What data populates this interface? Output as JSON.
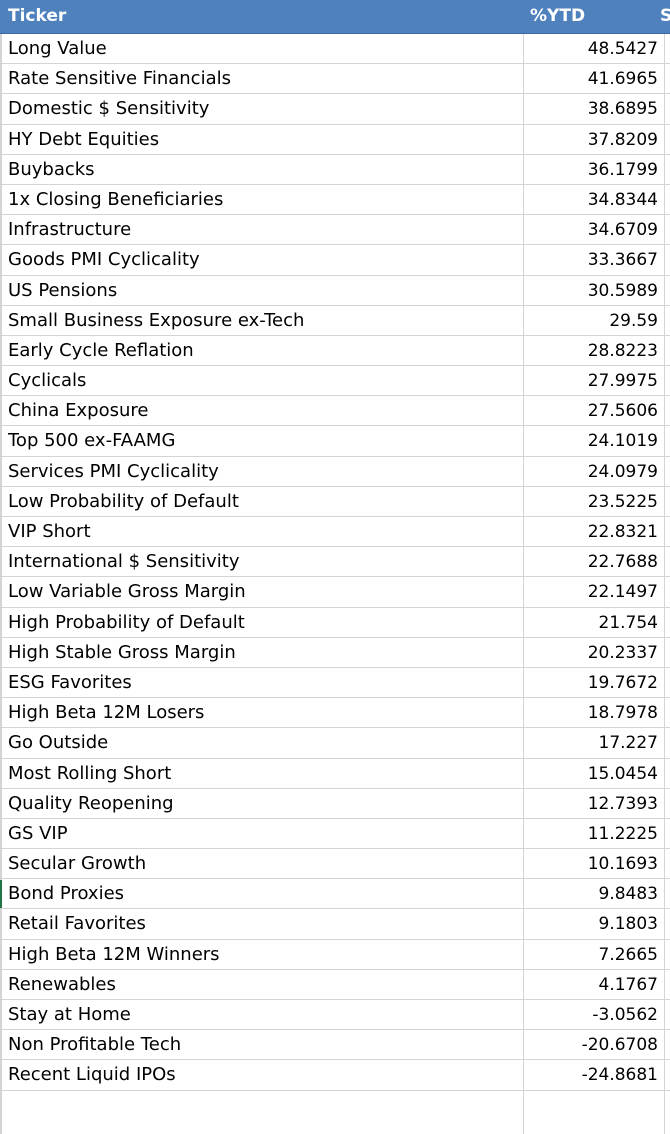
{
  "header": {
    "col_ticker": "Ticker",
    "col_ytd": "%YTD",
    "col_next": "S"
  },
  "rows": [
    {
      "name": "Long Value",
      "ytd": "48.5427"
    },
    {
      "name": "Rate Sensitive Financials",
      "ytd": "41.6965"
    },
    {
      "name": "Domestic $ Sensitivity",
      "ytd": "38.6895"
    },
    {
      "name": "HY Debt Equities",
      "ytd": "37.8209"
    },
    {
      "name": "Buybacks",
      "ytd": "36.1799"
    },
    {
      "name": "1x Closing Beneficiaries",
      "ytd": "34.8344"
    },
    {
      "name": "Infrastructure",
      "ytd": "34.6709"
    },
    {
      "name": "Goods PMI Cyclicality",
      "ytd": "33.3667"
    },
    {
      "name": "US Pensions",
      "ytd": "30.5989"
    },
    {
      "name": "Small Business Exposure ex-Tech",
      "ytd": "29.59"
    },
    {
      "name": "Early Cycle Reflation",
      "ytd": "28.8223"
    },
    {
      "name": "Cyclicals",
      "ytd": "27.9975"
    },
    {
      "name": "China Exposure",
      "ytd": "27.5606"
    },
    {
      "name": "Top 500 ex-FAAMG",
      "ytd": "24.1019"
    },
    {
      "name": "Services PMI Cyclicality",
      "ytd": "24.0979"
    },
    {
      "name": "Low Probability of Default",
      "ytd": "23.5225"
    },
    {
      "name": "VIP Short",
      "ytd": "22.8321"
    },
    {
      "name": "International $ Sensitivity",
      "ytd": "22.7688"
    },
    {
      "name": "Low Variable Gross Margin",
      "ytd": "22.1497"
    },
    {
      "name": "High Probability of Default",
      "ytd": "21.754"
    },
    {
      "name": "High Stable Gross Margin",
      "ytd": "20.2337"
    },
    {
      "name": "ESG Favorites",
      "ytd": "19.7672"
    },
    {
      "name": "High Beta 12M Losers",
      "ytd": "18.7978"
    },
    {
      "name": "Go Outside",
      "ytd": "17.227"
    },
    {
      "name": "Most Rolling Short",
      "ytd": "15.0454"
    },
    {
      "name": "Quality Reopening",
      "ytd": "12.7393"
    },
    {
      "name": "GS VIP",
      "ytd": "11.2225"
    },
    {
      "name": "Secular Growth",
      "ytd": "10.1693"
    },
    {
      "name": "Bond Proxies",
      "ytd": "9.8483"
    },
    {
      "name": "Retail Favorites",
      "ytd": "9.1803"
    },
    {
      "name": "High Beta 12M Winners",
      "ytd": "7.2665"
    },
    {
      "name": "Renewables",
      "ytd": "4.1767"
    },
    {
      "name": "Stay at Home",
      "ytd": "-3.0562"
    },
    {
      "name": "Non Profitable Tech",
      "ytd": "-20.6708"
    },
    {
      "name": "Recent Liquid IPOs",
      "ytd": "-24.8681"
    }
  ]
}
